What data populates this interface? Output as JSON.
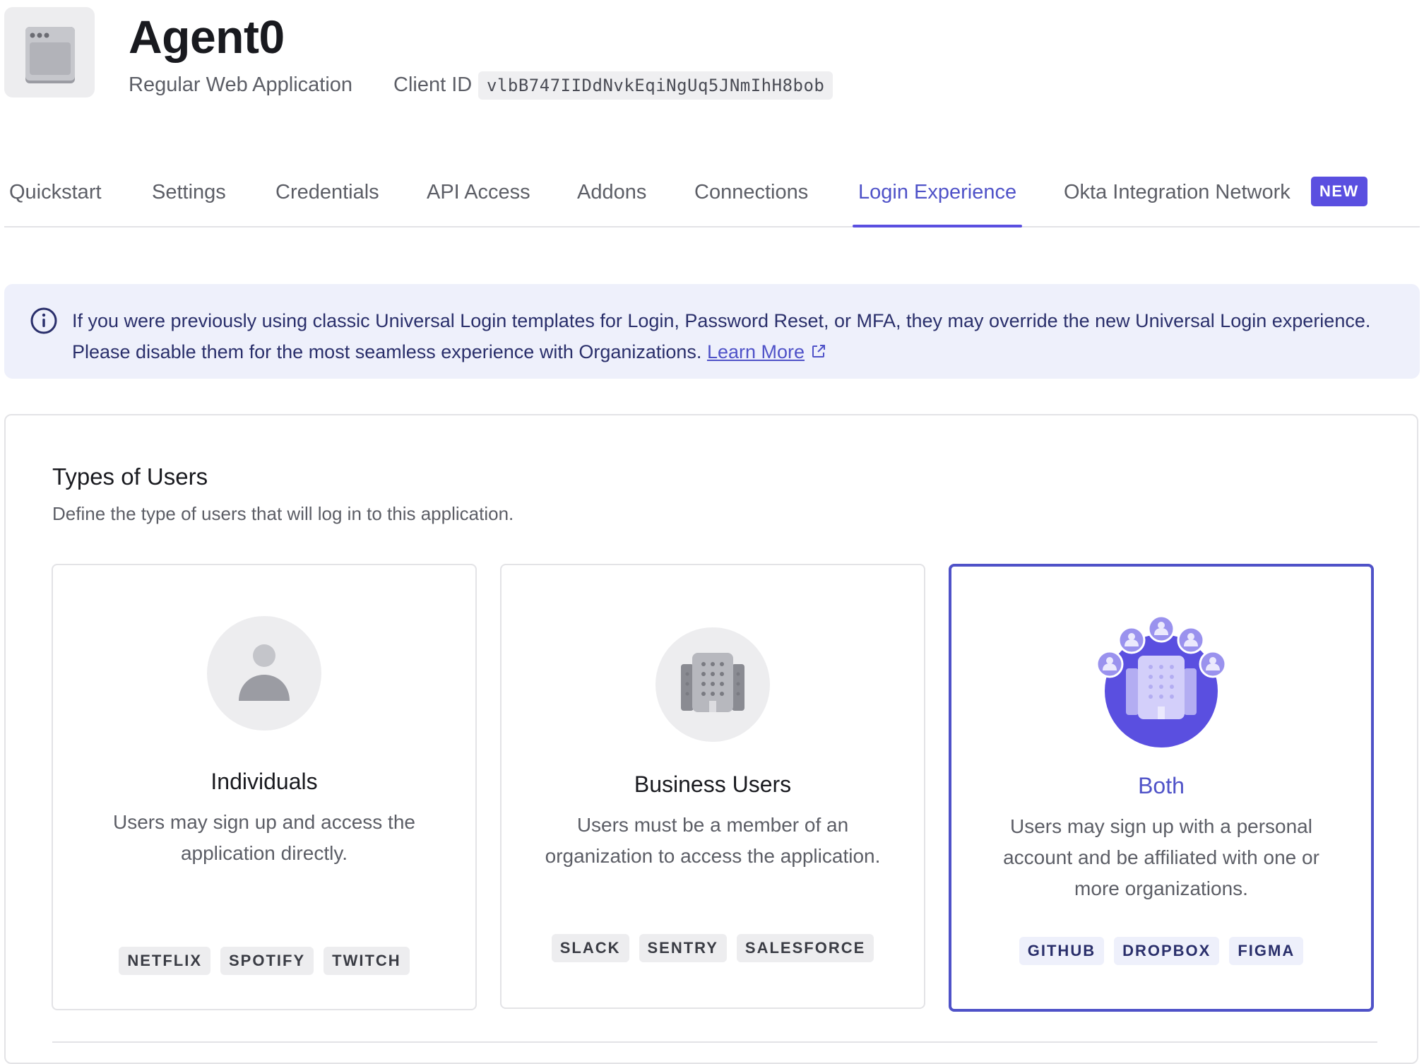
{
  "app": {
    "name": "Agent0",
    "type": "Regular Web Application",
    "client_id_label": "Client ID",
    "client_id": "vlbB747IIDdNvkEqiNgUq5JNmIhH8bob",
    "icon": "browser-window-icon"
  },
  "tabs": [
    {
      "label": "Quickstart",
      "active": false
    },
    {
      "label": "Settings",
      "active": false
    },
    {
      "label": "Credentials",
      "active": false
    },
    {
      "label": "API Access",
      "active": false
    },
    {
      "label": "Addons",
      "active": false
    },
    {
      "label": "Connections",
      "active": false
    },
    {
      "label": "Login Experience",
      "active": true
    },
    {
      "label": "Okta Integration Network",
      "active": false,
      "badge": "NEW"
    }
  ],
  "banner": {
    "icon": "info-icon",
    "text": "If you were previously using classic Universal Login templates for Login, Password Reset, or MFA, they may override the new Universal Login experience. Please disable them for the most seamless experience with Organizations.",
    "link_label": "Learn More",
    "link_icon": "external-link-icon"
  },
  "users_section": {
    "title": "Types of Users",
    "description": "Define the type of users that will log in to this application.",
    "options": [
      {
        "title": "Individuals",
        "description": "Users may sign up and access the application directly.",
        "tags": [
          "NETFLIX",
          "SPOTIFY",
          "TWITCH"
        ],
        "icon": "person-icon",
        "selected": false
      },
      {
        "title": "Business Users",
        "description": "Users must be a member of an organization to access the application.",
        "tags": [
          "SLACK",
          "SENTRY",
          "SALESFORCE"
        ],
        "icon": "building-icon",
        "selected": false
      },
      {
        "title": "Both",
        "description": "Users may sign up with a personal account and be affiliated with one or more organizations.",
        "tags": [
          "GITHUB",
          "DROPBOX",
          "FIGMA"
        ],
        "icon": "building-with-users-icon",
        "selected": true
      }
    ]
  },
  "colors": {
    "accent": "#5a4fe0",
    "accent_text": "#4f52c8",
    "banner_bg": "#eef0fb",
    "muted_text": "#5c5e66",
    "border": "#e3e3e6"
  }
}
